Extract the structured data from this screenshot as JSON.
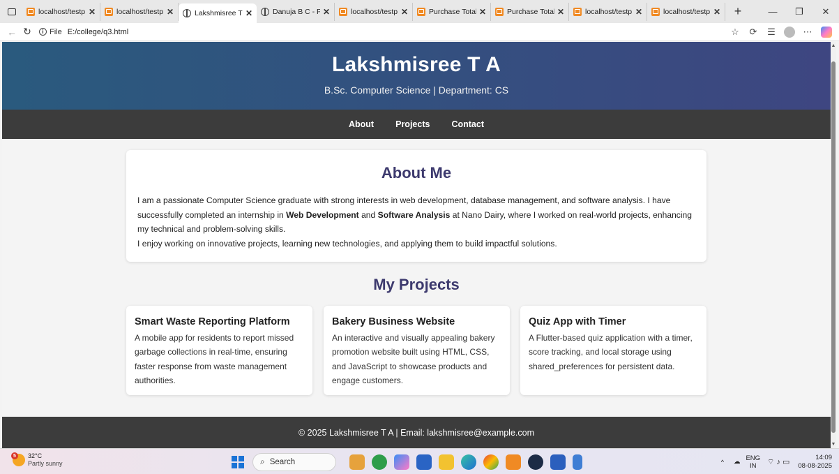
{
  "browser": {
    "tabs": [
      {
        "label": "localhost/testp",
        "icon": "xampp-icon",
        "active": false
      },
      {
        "label": "localhost/testp",
        "icon": "xampp-icon",
        "active": false
      },
      {
        "label": "Lakshmisree T",
        "icon": "globe-icon",
        "active": true
      },
      {
        "label": "Danuja B C - P",
        "icon": "globe-icon",
        "active": false
      },
      {
        "label": "localhost/testp",
        "icon": "xampp-icon",
        "active": false
      },
      {
        "label": "Purchase Total",
        "icon": "xampp-icon",
        "active": false
      },
      {
        "label": "Purchase Total",
        "icon": "xampp-icon",
        "active": false
      },
      {
        "label": "localhost/testp",
        "icon": "xampp-icon",
        "active": false
      },
      {
        "label": "localhost/testp",
        "icon": "xampp-icon",
        "active": false
      }
    ],
    "tab_close_glyph": "✕",
    "new_tab_glyph": "+",
    "address": {
      "scheme_label": "File",
      "url": "E:/college/q3.html"
    }
  },
  "site": {
    "name": "Lakshmisree T A",
    "subtitle": "B.Sc. Computer Science | Department: CS",
    "nav": [
      "About",
      "Projects",
      "Contact"
    ],
    "about": {
      "heading": "About Me",
      "p1_a": "I am a passionate Computer Science graduate with strong interests in web development, database management, and software analysis. I have successfully completed an internship in ",
      "p1_b": "Web Development",
      "p1_c": " and ",
      "p1_d": "Software Analysis",
      "p1_e": " at Nano Dairy, where I worked on real-world projects, enhancing my technical and problem-solving skills.",
      "p2": "I enjoy working on innovative projects, learning new technologies, and applying them to build impactful solutions."
    },
    "projects_heading": "My Projects",
    "projects": [
      {
        "title": "Smart Waste Reporting Platform",
        "desc": "A mobile app for residents to report missed garbage collections in real-time, ensuring faster response from waste management authorities."
      },
      {
        "title": "Bakery Business Website",
        "desc": "An interactive and visually appealing bakery promotion website built using HTML, CSS, and JavaScript to showcase products and engage customers."
      },
      {
        "title": "Quiz App with Timer",
        "desc": "A Flutter-based quiz application with a timer, score tracking, and local storage using shared_preferences for persistent data."
      }
    ],
    "footer": "© 2025 Lakshmisree T A | Email: lakshmisree@example.com"
  },
  "taskbar": {
    "weather_temp": "32°C",
    "weather_desc": "Partly sunny",
    "weather_badge": "5",
    "search_placeholder": "Search",
    "lang_top": "ENG",
    "lang_bottom": "IN",
    "time": "14:09",
    "date": "08-08-2025"
  },
  "colors": {
    "hero_start": "#2a5a7e",
    "hero_end": "#3e4681",
    "nav_bg": "#3c3c3c",
    "heading": "#3d3a6e"
  }
}
